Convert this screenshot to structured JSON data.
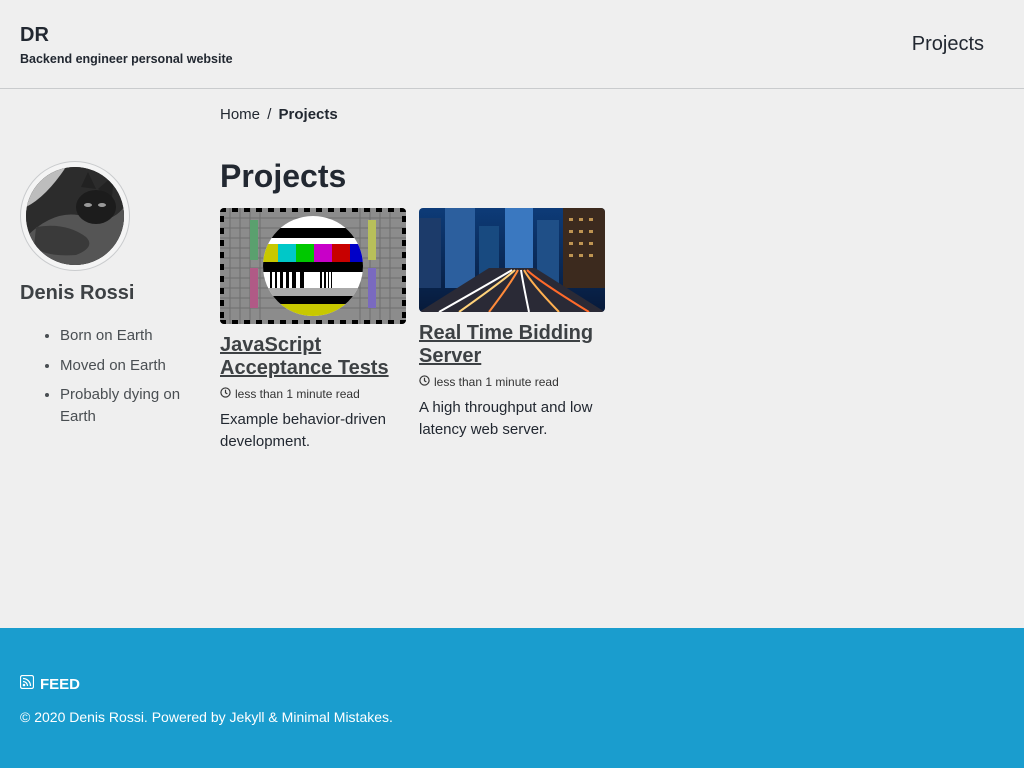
{
  "masthead": {
    "site_title": "DR",
    "subtitle": "Backend engineer personal website",
    "nav": {
      "projects": "Projects"
    }
  },
  "breadcrumbs": {
    "home": "Home",
    "separator": "/",
    "current": "Projects"
  },
  "sidebar": {
    "author_name": "Denis Rossi",
    "urls": [
      "Born on Earth",
      "Moved on Earth",
      "Probably dying on Earth"
    ]
  },
  "main": {
    "title": "Projects",
    "projects": [
      {
        "title": "JavaScript Acceptance Tests",
        "read_time": "less than 1 minute read",
        "excerpt": "Example behavior-driven development."
      },
      {
        "title": "Real Time Bidding Server",
        "read_time": "less than 1 minute read",
        "excerpt": "A high throughput and low latency web server."
      }
    ]
  },
  "footer": {
    "feed": "FEED",
    "copyright_prefix": "© 2020 Denis Rossi. Powered by ",
    "jekyll": "Jekyll",
    "amp": " & ",
    "minimal_mistakes": "Minimal Mistakes",
    "period": "."
  },
  "colors": {
    "footer_bg": "#1a9dce",
    "page_bg": "#efefef",
    "text": "#222831"
  },
  "icons": [
    "clock-icon",
    "rss-icon"
  ]
}
